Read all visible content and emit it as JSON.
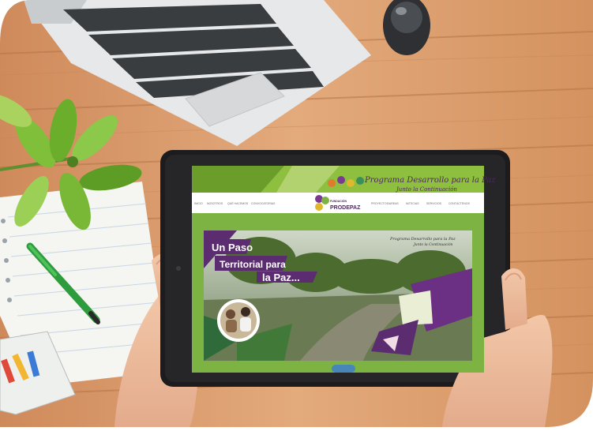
{
  "site": {
    "program_title_line1": "Programa Desarrollo para la Paz",
    "program_title_line2": "Junto la Continuación",
    "brand_small": "FUNDACIÓN",
    "brand_large": "PRODEPAZ",
    "nav_left": [
      "INICIO",
      "NOSOTROS",
      "QUÉ HACEMOS",
      "CONVOCATORIAS"
    ],
    "nav_right": [
      "PROYECTOS/AREAS",
      "NOTICIAS",
      "SERVICIOS",
      "CONTÁCTENOS"
    ]
  },
  "hero": {
    "line1": "Un Paso",
    "line2": "Territorial para",
    "line3": "la Paz...",
    "caption_line1": "Programa Desarrollo para la Paz",
    "caption_line2": "Junto la Continuación"
  },
  "colors": {
    "wood": "#d99a6c",
    "site_green": "#7cb342",
    "hero_purple": "#5b2c6f",
    "tablet_frame": "#1c1c1e"
  },
  "icons": [
    "laptop",
    "mouse",
    "plant",
    "notebook",
    "pen",
    "pencil-cup",
    "tablet",
    "hands"
  ]
}
